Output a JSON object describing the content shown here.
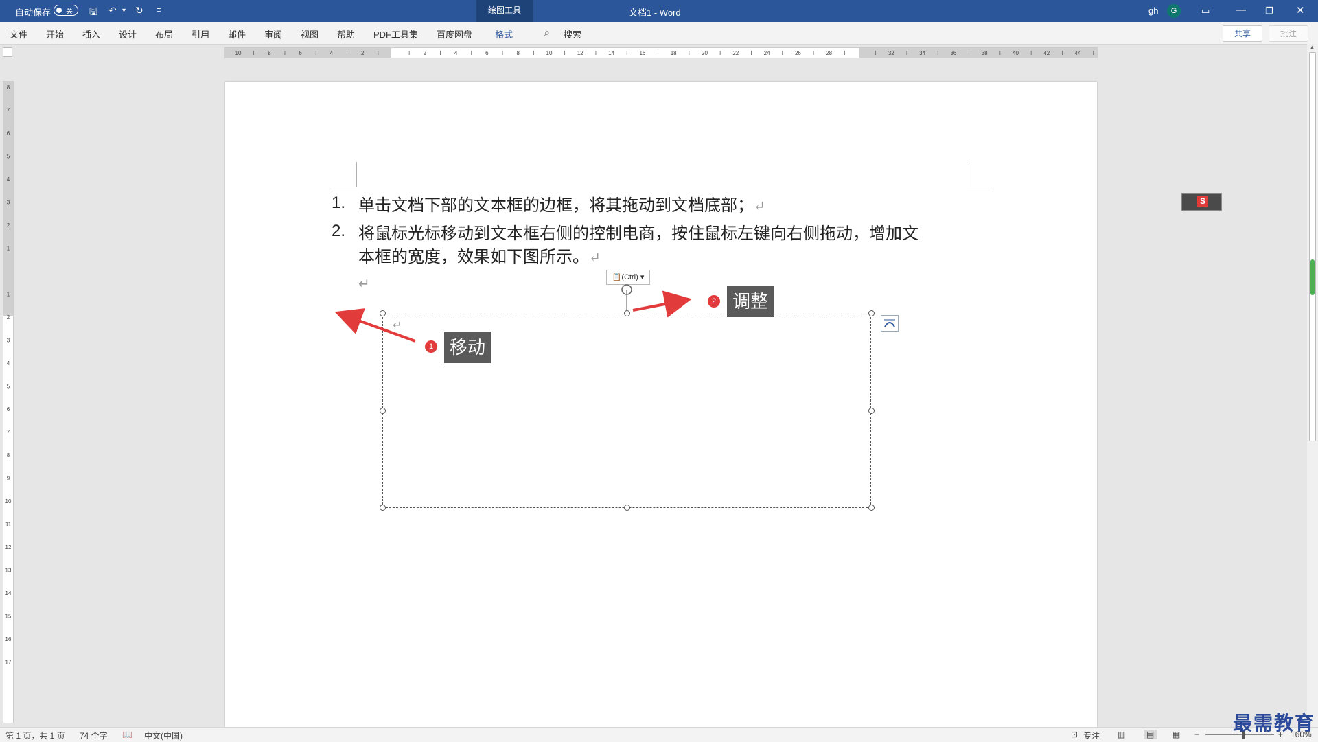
{
  "titlebar": {
    "autosave_label": "自动保存",
    "autosave_state": "关",
    "context_tab": "绘图工具",
    "doc_title": "文档1  -  Word",
    "user_name": "gh",
    "user_initial": "G"
  },
  "ribbon": {
    "tabs": [
      "文件",
      "开始",
      "插入",
      "设计",
      "布局",
      "引用",
      "邮件",
      "审阅",
      "视图",
      "帮助",
      "PDF工具集",
      "百度网盘",
      "格式"
    ],
    "active_tab": "格式",
    "search": "搜索",
    "share": "共享",
    "comment": "批注"
  },
  "ruler": {
    "h_labels": [
      "10",
      "8",
      "6",
      "4",
      "2",
      "",
      "2",
      "4",
      "6",
      "8",
      "10",
      "12",
      "14",
      "16",
      "18",
      "20",
      "22",
      "24",
      "26",
      "28",
      "",
      "32",
      "34",
      "36",
      "38",
      "40",
      "42",
      "44"
    ],
    "v_labels": [
      "8",
      "7",
      "6",
      "5",
      "4",
      "3",
      "2",
      "1",
      "",
      "1",
      "2",
      "3",
      "4",
      "5",
      "6",
      "7",
      "8",
      "9",
      "10",
      "11",
      "12",
      "13",
      "14",
      "15",
      "16",
      "17"
    ]
  },
  "document": {
    "items": [
      {
        "number": "1.",
        "text": "单击文档下部的文本框的边框，将其拖动到文档底部；"
      },
      {
        "number": "2.",
        "text_line1": "将鼠标光标移动到文本框右侧的控制电商，按住鼠标左键向右侧拖动，增加文",
        "text_line2": "本框的宽度，效果如下图所示。"
      }
    ],
    "paragraph_mark": "↵",
    "paste_options": "(Ctrl)"
  },
  "annotations": {
    "move": {
      "badge": "1",
      "label": "移动"
    },
    "adjust": {
      "badge": "2",
      "label": "调整"
    },
    "arrow_color": "#e23b3b"
  },
  "statusbar": {
    "page": "第 1 页，共 1 页",
    "words": "74 个字",
    "language": "中文(中国)",
    "focus": "专注",
    "zoom": "160%",
    "zoom_minus": "−",
    "zoom_plus": "+"
  },
  "watermark": "最需教育",
  "colors": {
    "brand": "#2b579a",
    "badge": "#e23b3b",
    "callout": "#5a5a5a"
  }
}
